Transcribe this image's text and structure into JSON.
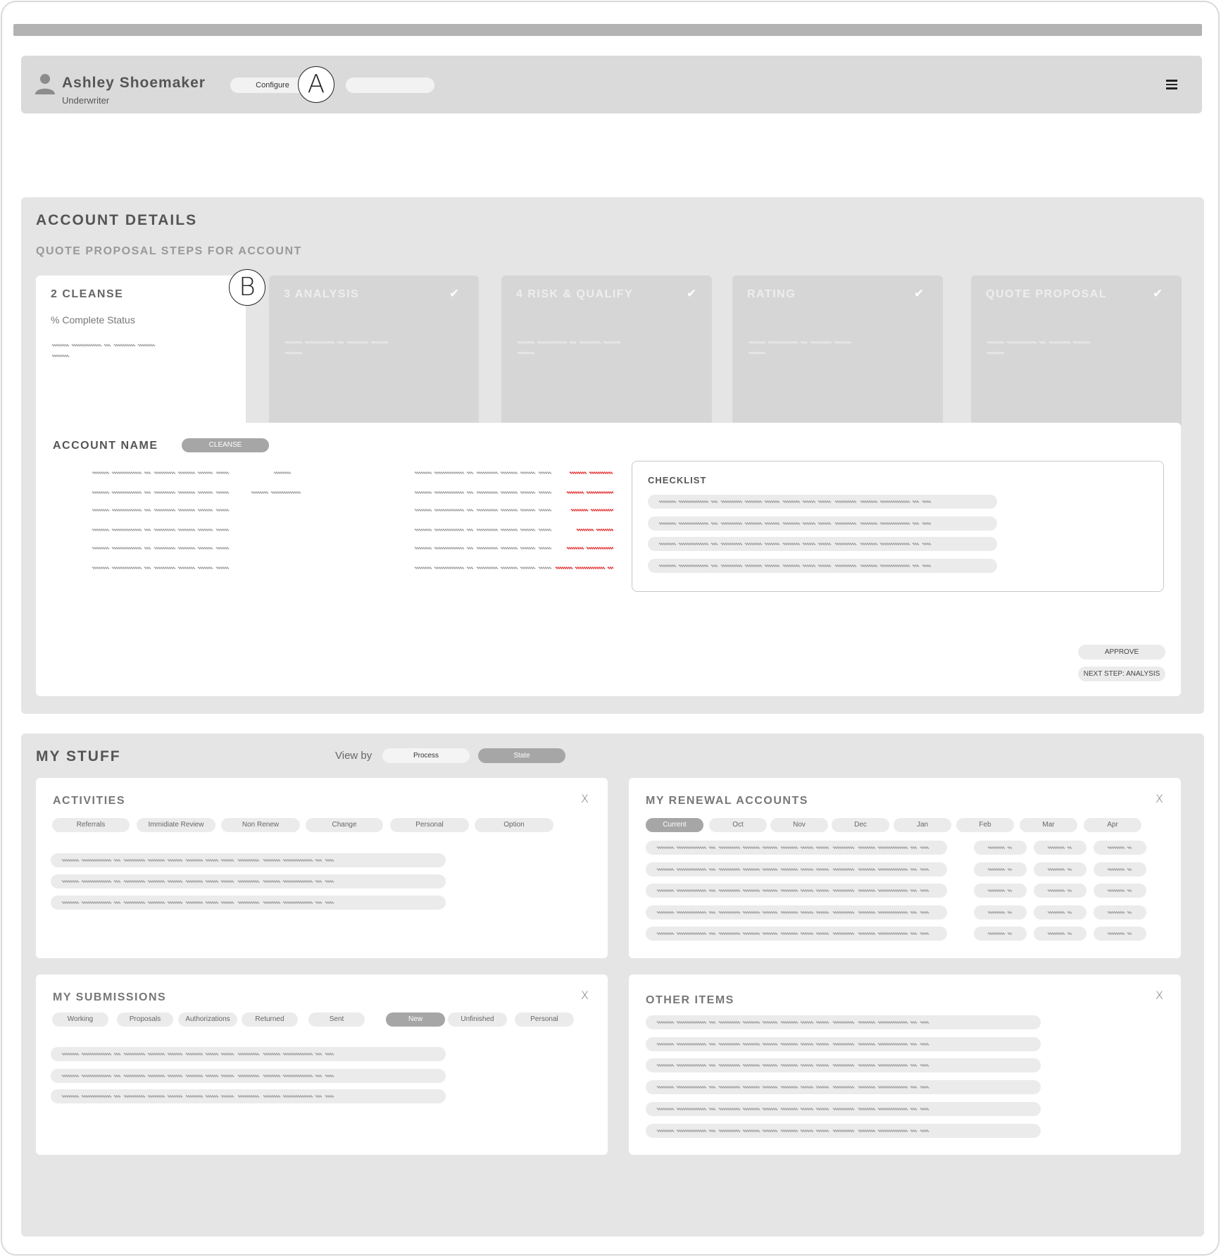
{
  "header": {
    "user_name": "Ashley Shoemaker",
    "user_role": "Underwriter",
    "configure_label": "Configure",
    "marker_a": "A"
  },
  "account_details": {
    "title": "ACCOUNT DETAILS",
    "subtitle": "QUOTE PROPOSAL STEPS FOR ACCOUNT",
    "marker_b": "B",
    "steps": [
      {
        "label": "2 CLEANSE",
        "status": "% Complete Status"
      },
      {
        "label": "3 ANALYSIS"
      },
      {
        "label": "4 RISK & QUALIFY"
      },
      {
        "label": "RATING"
      },
      {
        "label": "QUOTE PROPOSAL"
      }
    ],
    "account_name": "ACCOUNT NAME",
    "badge": "CLEANSE",
    "checklist_title": "CHECKLIST",
    "approve_label": "APPROVE",
    "next_step_label": "NEXT STEP: ANALYSIS"
  },
  "my_stuff": {
    "title": "MY STUFF",
    "view_by": "View by",
    "toggle_process": "Process",
    "toggle_state": "State",
    "activities": {
      "title": "ACTIVITIES",
      "close": "X",
      "chips": [
        "Referrals",
        "Immidiate Review",
        "Non Renew",
        "Change",
        "Personal",
        "Option"
      ]
    },
    "renewals": {
      "title": "MY RENEWAL  ACCOUNTS",
      "close": "X",
      "chips": [
        "Current",
        "Oct",
        "Nov",
        "Dec",
        "Jan",
        "Feb",
        "Mar",
        "Apr"
      ],
      "selected": "Current"
    },
    "submissions": {
      "title": "MY SUBMISSIONS",
      "close": "X",
      "chips": [
        "Working",
        "Proposals",
        "Authorizations",
        "Returned",
        "Sent",
        "New",
        "Unfinished",
        "Personal"
      ],
      "selected": "New"
    },
    "other": {
      "title": "OTHER ITEMS",
      "close": "X"
    }
  },
  "colors": {
    "header_bg": "#dadada",
    "panel_bg": "#e5e5e5",
    "selected_chip": "#a6a6a6",
    "squiggle": "#999999",
    "squiggle_alert": "#e02020"
  }
}
